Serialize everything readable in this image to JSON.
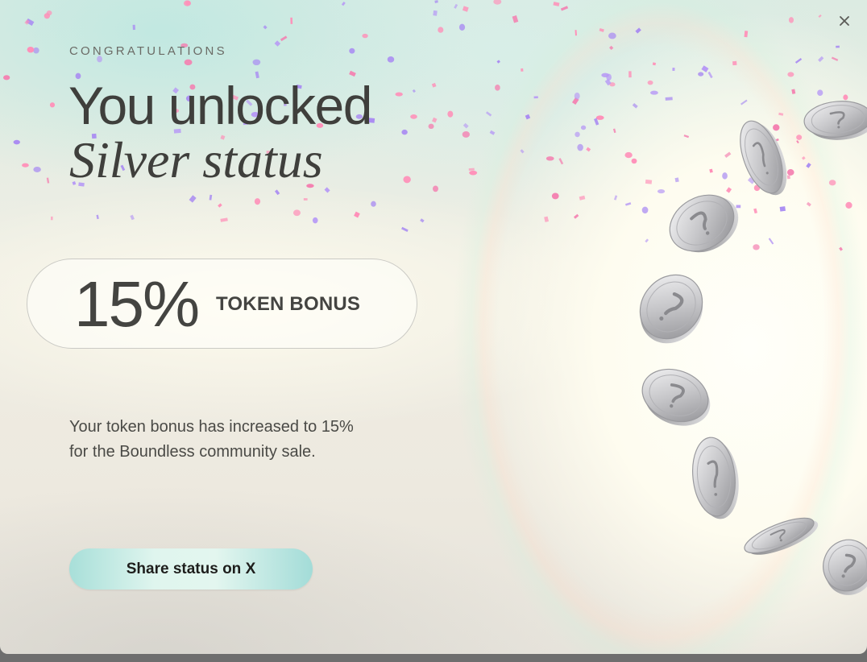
{
  "modal": {
    "eyebrow": "CONGRATULATIONS",
    "title_line_1": "You unlocked",
    "title_line_2": "Silver status",
    "bonus": {
      "value": "15%",
      "label": "TOKEN BONUS"
    },
    "description_line_1": "Your token bonus has increased to 15%",
    "description_line_2": "for the Boundless community sale.",
    "share_button_label": "Share status on X",
    "close_icon": "close-icon"
  },
  "colors": {
    "text_primary": "#3f3f3c",
    "button_gradient_edge": "#a8dfd9",
    "button_gradient_center": "#e3f6ef",
    "confetti": [
      "#ff8fb8",
      "#a98bf2",
      "#f47fb0",
      "#b79af5"
    ],
    "coin_silver": "#c9c9cb"
  },
  "decorations": {
    "coins": "silver-coin-icon",
    "confetti": "confetti"
  }
}
